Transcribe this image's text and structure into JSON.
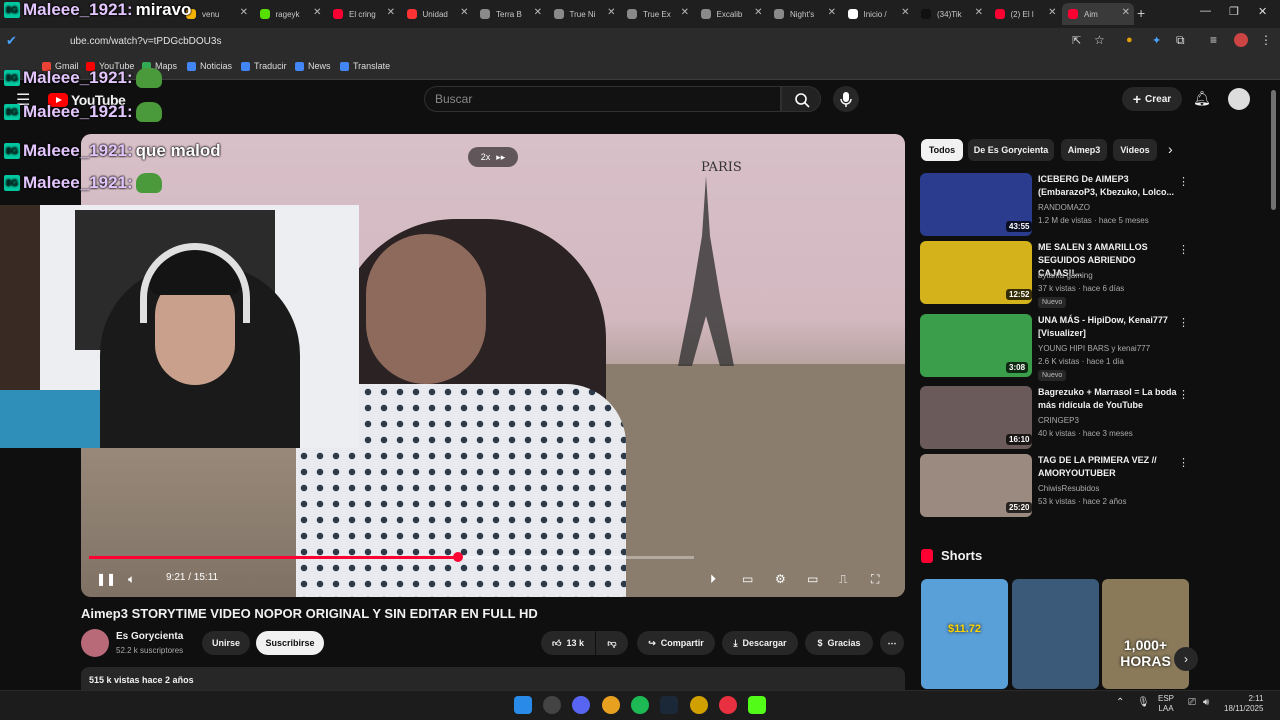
{
  "browser": {
    "tabs": [
      {
        "label": "venu",
        "color": "#f5b400"
      },
      {
        "label": "rageyk",
        "color": "#55e000"
      },
      {
        "label": "El cring",
        "color": "#ff0033"
      },
      {
        "label": "Unidad",
        "color": "#ff3333"
      },
      {
        "label": "Terra B",
        "color": "#8a8a8a"
      },
      {
        "label": "True Ni",
        "color": "#8a8a8a"
      },
      {
        "label": "True Ex",
        "color": "#8a8a8a"
      },
      {
        "label": "Excalib",
        "color": "#8a8a8a"
      },
      {
        "label": "Night's",
        "color": "#8a8a8a"
      },
      {
        "label": "Inicio /",
        "color": "#ffffff"
      },
      {
        "label": "(34)Tik",
        "color": "#111111"
      },
      {
        "label": "(2) El l",
        "color": "#ff0033"
      },
      {
        "label": "Aim",
        "color": "#ff0033"
      }
    ],
    "url": "ube.com/watch?v=tPDGcbDOU3s",
    "bookmarks": [
      "Gmail",
      "YouTube",
      "Maps",
      "Noticias",
      "Traducir",
      "News",
      "Translate"
    ]
  },
  "chat": [
    {
      "user": "Maleee_1921:",
      "message": "miravo",
      "emote": false
    },
    {
      "user": "Maleee_1921:",
      "message": "",
      "emote": true
    },
    {
      "user": "Maleee_1921:",
      "message": "",
      "emote": true
    },
    {
      "user": "Maleee_1921:",
      "message": "que malod",
      "emote": false
    },
    {
      "user": "Maleee_1921:",
      "message": "",
      "emote": true
    }
  ],
  "youtube": {
    "logo_text": "YouTube",
    "search_placeholder": "Buscar",
    "create_label": "Crear",
    "speed_label": "2x",
    "poster_text": "PARIS",
    "player": {
      "progress_fraction": 0.61,
      "time": "9:21 / 15:11"
    },
    "video": {
      "title": "Aimep3 STORYTIME VIDEO NOPOR ORIGINAL Y SIN EDITAR EN FULL HD",
      "channel": "Es Gorycienta",
      "subscribers": "52.2 k suscriptores",
      "join_label": "Unirse",
      "subscribe_label": "Suscribirse",
      "likes": "13 k",
      "share_label": "Compartir",
      "download_label": "Descargar",
      "thanks_label": "Gracias",
      "views_date": "515 k vistas  hace 2 años"
    },
    "chips": [
      "Todos",
      "De Es Gorycienta",
      "Aimep3",
      "Videos"
    ],
    "recommendations": [
      {
        "title": "ICEBERG De AIMEP3 (EmbarazoP3, Kbezuko, Lolco...",
        "channel": "RANDOMAZO",
        "meta": "1.2 M de vistas · hace 5 meses",
        "duration": "43:55",
        "nuevo": "",
        "thumb_color": "#2b3c8f"
      },
      {
        "title": "ME SALEN 3 AMARILLOS SEGUIDOS ABRIENDO CAJAS!!...",
        "channel": "bytarifa gaming",
        "meta": "37 k vistas · hace 6 días",
        "duration": "12:52",
        "nuevo": "Nuevo",
        "thumb_color": "#d4b21c"
      },
      {
        "title": "UNA MÁS - HipiDow, Kenai777 [Visualizer]",
        "channel": "YOUNG HIPI BARS y kenai777",
        "meta": "2.6 K vistas · hace 1 día",
        "duration": "3:08",
        "nuevo": "Nuevo",
        "thumb_color": "#3a9e4a"
      },
      {
        "title": "Bagrezuko + Marrasol = La boda más ridícula de YouTube",
        "channel": "CRINGEP3",
        "meta": "40 k vistas · hace 3 meses",
        "duration": "16:10",
        "nuevo": "",
        "thumb_color": "#6a5a5a"
      },
      {
        "title": "TAG DE LA PRIMERA VEZ // AMORYOUTUBER",
        "channel": "ChiwisResubidos",
        "meta": "53 k vistas · hace 2 años",
        "duration": "25:20",
        "nuevo": "",
        "thumb_color": "#9a8a80"
      }
    ],
    "shorts_title": "Shorts",
    "shorts": [
      {
        "caption": "$11.72",
        "color": "#5aa0d8"
      },
      {
        "caption": "",
        "color": "#3b5a7a"
      },
      {
        "caption": "1,000+ HORAS",
        "color": "#8a7a5a"
      }
    ]
  },
  "taskbar": {
    "lang": "ESP",
    "lang2": "LAA",
    "time": "2:11",
    "date": "18/11/2025"
  }
}
